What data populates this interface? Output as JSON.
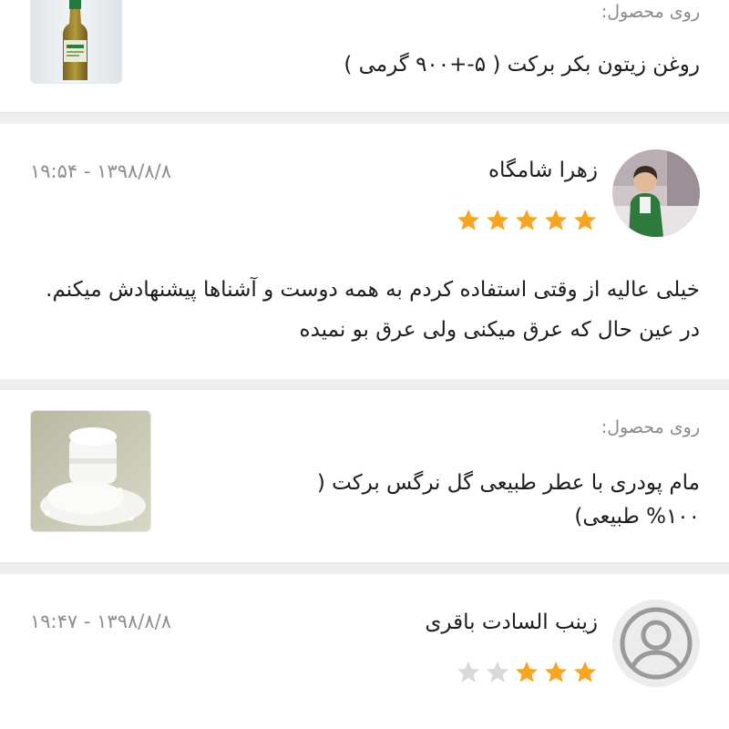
{
  "products": [
    {
      "label": "روی محصول:",
      "name": "روغن زیتون بکر برکت ( ۵-+۹۰۰ گرمی )",
      "image": "olive-oil-bottle"
    },
    {
      "label": "روی محصول:",
      "name": "مام پودری با عطر طبیعی گل نرگس برکت ( ۱۰۰% طبیعی)",
      "image": "powder-deodorant-jar"
    }
  ],
  "reviews": [
    {
      "user": "زهرا شامگاه",
      "date": "۱۳۹۸/۸/۸ - ۱۹:۵۴",
      "rating": 5,
      "max_rating": 5,
      "avatar": "user-photo",
      "comment": "خیلی عالیه از وقتی استفاده کردم به همه دوست و آشناها پیشنهادش میکنم. در عین حال که عرق میکنی ولی عرق بو نمیده"
    },
    {
      "user": "زینب السادت باقری",
      "date": "۱۳۹۸/۸/۸ - ۱۹:۴۷",
      "rating": 3,
      "max_rating": 5,
      "avatar": "default-user-icon",
      "comment": ""
    }
  ],
  "colors": {
    "star_filled": "#f5a623",
    "star_empty": "#d9d9d9",
    "text_primary": "#1d1d1d",
    "text_muted": "#8a8a8a",
    "background": "#eeeeee"
  }
}
